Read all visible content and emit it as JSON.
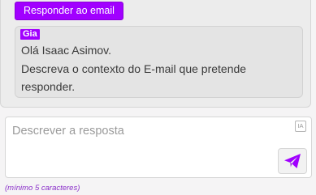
{
  "chat": {
    "reply_button_label": "Responder ao email",
    "message": {
      "sender": "Gia",
      "lines": [
        "Olá Isaac Asimov.",
        "Descreva o contexto do E-mail que pretende",
        "responder."
      ]
    }
  },
  "composer": {
    "placeholder": "Descrever a resposta",
    "value": "",
    "ia_icon_label": "IA",
    "hint": "(mínimo 5 caracteres)"
  },
  "colors": {
    "accent": "#a100ff",
    "hint": "#8a2fc9"
  },
  "icons": {
    "send": "send-icon",
    "ia": "ia-icon"
  }
}
